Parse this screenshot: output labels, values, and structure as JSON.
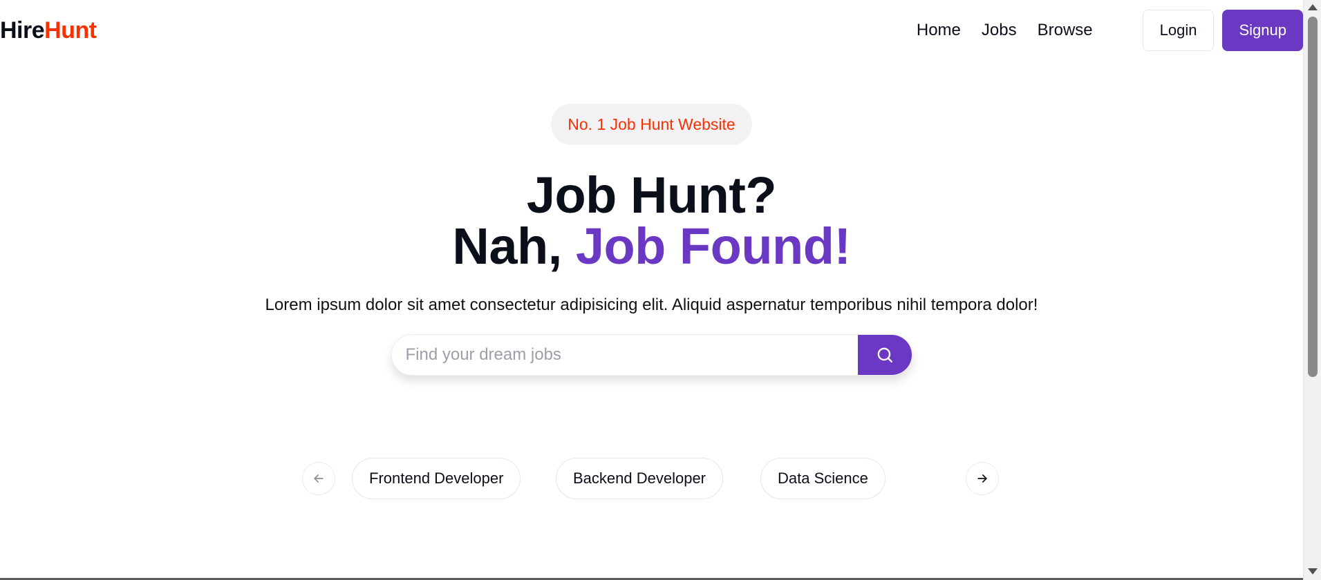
{
  "brand": {
    "part1": "Hire",
    "part2": "Hunt"
  },
  "nav": {
    "links": [
      "Home",
      "Jobs",
      "Browse"
    ],
    "login": "Login",
    "signup": "Signup"
  },
  "hero": {
    "badge": "No. 1 Job Hunt Website",
    "line1": "Job Hunt?",
    "line2_plain": "Nah, ",
    "line2_accent": "Job Found!",
    "subtitle": "Lorem ipsum dolor sit amet consectetur adipisicing elit. Aliquid aspernatur temporibus nihil tempora dolor!"
  },
  "search": {
    "placeholder": "Find your dream jobs",
    "value": "",
    "icon": "search-icon"
  },
  "categories": [
    "Frontend Developer",
    "Backend Developer",
    "Data Science"
  ],
  "colors": {
    "accent": "#6a38c2",
    "brand_red": "#f83002",
    "text": "#0b0f1a"
  }
}
